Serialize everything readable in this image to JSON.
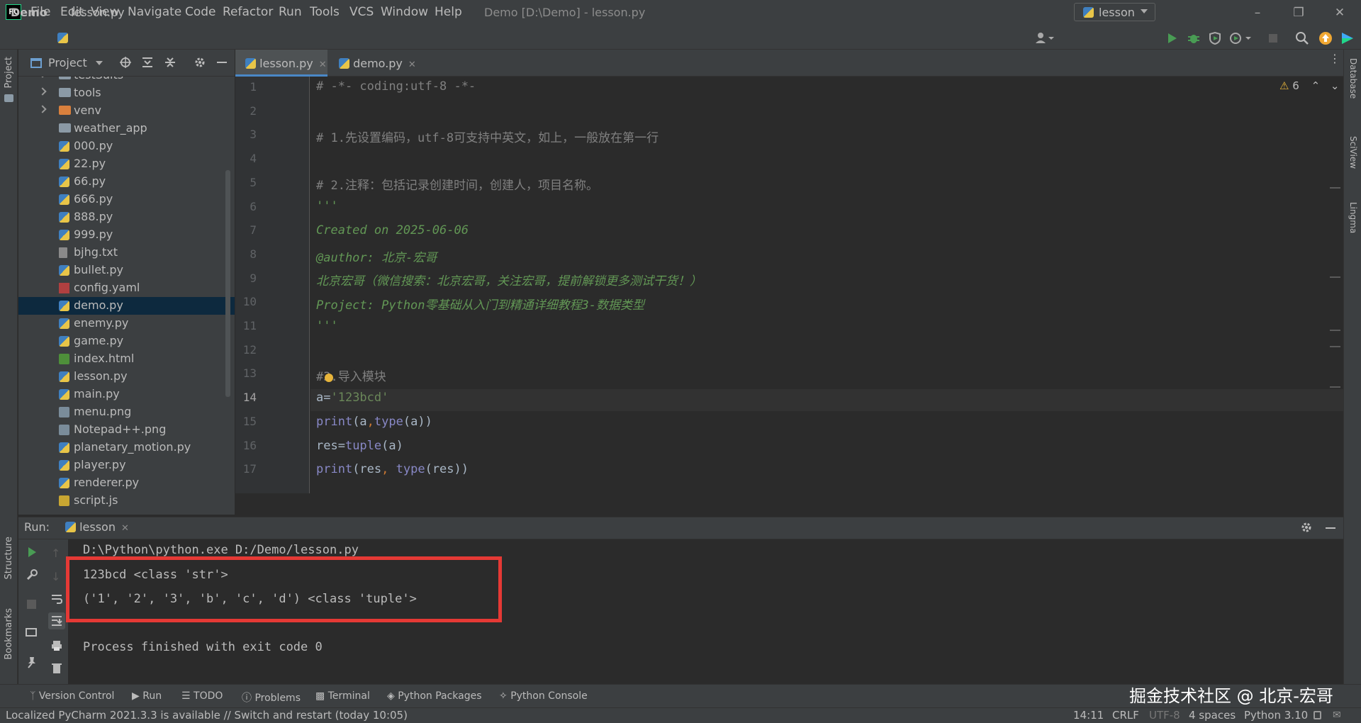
{
  "app": {
    "logo_text": "PC",
    "window_title": "Demo [D:\\Demo] - lesson.py",
    "menu": [
      "File",
      "Edit",
      "View",
      "Navigate",
      "Code",
      "Refactor",
      "Run",
      "Tools",
      "VCS",
      "Window",
      "Help"
    ]
  },
  "navbar": {
    "project": "Demo",
    "file": "lesson.py",
    "run_config": "lesson"
  },
  "left_stripe": {
    "project": "Project",
    "structure": "Structure",
    "bookmarks": "Bookmarks"
  },
  "right_stripe": {
    "database": "Database",
    "sciview": "SciView",
    "lingma": "Lingma"
  },
  "project_panel": {
    "title": "Project",
    "items": [
      {
        "label": "testSuits",
        "kind": "folder",
        "expandable": true
      },
      {
        "label": "tools",
        "kind": "folder",
        "expandable": true
      },
      {
        "label": "venv",
        "kind": "folder-orange",
        "expandable": true
      },
      {
        "label": "weather_app",
        "kind": "folder",
        "expandable": false
      },
      {
        "label": "000.py",
        "kind": "py"
      },
      {
        "label": "22.py",
        "kind": "py"
      },
      {
        "label": "66.py",
        "kind": "py"
      },
      {
        "label": "666.py",
        "kind": "py"
      },
      {
        "label": "888.py",
        "kind": "py"
      },
      {
        "label": "999.py",
        "kind": "py"
      },
      {
        "label": "bjhg.txt",
        "kind": "txt"
      },
      {
        "label": "bullet.py",
        "kind": "py"
      },
      {
        "label": "config.yaml",
        "kind": "yml"
      },
      {
        "label": "demo.py",
        "kind": "py",
        "selected": true
      },
      {
        "label": "enemy.py",
        "kind": "py"
      },
      {
        "label": "game.py",
        "kind": "py"
      },
      {
        "label": "index.html",
        "kind": "html"
      },
      {
        "label": "lesson.py",
        "kind": "py"
      },
      {
        "label": "main.py",
        "kind": "py"
      },
      {
        "label": "menu.png",
        "kind": "png"
      },
      {
        "label": "Notepad++.png",
        "kind": "png"
      },
      {
        "label": "planetary_motion.py",
        "kind": "py"
      },
      {
        "label": "player.py",
        "kind": "py"
      },
      {
        "label": "renderer.py",
        "kind": "py"
      },
      {
        "label": "script.js",
        "kind": "js"
      }
    ]
  },
  "editor": {
    "tabs": [
      {
        "label": "lesson.py",
        "active": true
      },
      {
        "label": "demo.py",
        "active": false
      }
    ],
    "warnings": "6",
    "current_line": 14,
    "line_numbers": [
      "1",
      "2",
      "3",
      "4",
      "5",
      "6",
      "7",
      "8",
      "9",
      "10",
      "11",
      "12",
      "13",
      "14",
      "15",
      "16",
      "17"
    ]
  },
  "code": {
    "l1": "# -*- coding:utf-8 -*-",
    "l3": "# 1.先设置编码，utf-8可支持中英文，如上，一般放在第一行",
    "l5": "# 2.注释：包括记录创建时间，创建人，项目名称。",
    "l6": "'''",
    "l7": "Created on 2025-06-06",
    "l8": "@author: 北京-宏哥",
    "l9": "北京宏哥（微信搜索：北京宏哥，关注宏哥，提前解锁更多测试干货！）",
    "l10": "Project: Python零基础从入门到精通详细教程3-数据类型",
    "l11": "'''",
    "l13": "#3.导入模块",
    "l14a": "a=",
    "l14b": "'123bcd'",
    "l15a": "print",
    "l15b": "(a",
    "l15c": ",",
    "l15d": "type",
    "l15e": "(a))",
    "l16a": "res=",
    "l16b": "tuple",
    "l16c": "(a)",
    "l17a": "print",
    "l17b": "(res",
    "l17c": ", ",
    "l17d": "type",
    "l17e": "(res))"
  },
  "run": {
    "label": "Run:",
    "tab": "lesson",
    "console": [
      "D:\\Python\\python.exe D:/Demo/lesson.py",
      "123bcd <class 'str'>",
      "('1', '2', '3', 'b', 'c', 'd') <class 'tuple'>",
      "",
      "Process finished with exit code 0"
    ]
  },
  "bottom_tools": [
    "Version Control",
    "Run",
    "TODO",
    "Problems",
    "Terminal",
    "Python Packages",
    "Python Console"
  ],
  "watermark": "掘金技术社区 @ 北京-宏哥",
  "status": {
    "message": "Localized PyCharm 2021.3.3 is available // Switch and restart (today 10:05)",
    "position": "14:11",
    "line_sep": "CRLF",
    "encoding": "UTF-8",
    "indent": "4 spaces",
    "interpreter": "Python 3.10"
  },
  "colors": {
    "accent": "#4a88c7",
    "highlight_box": "#e53935",
    "selection": "#0d293e"
  }
}
